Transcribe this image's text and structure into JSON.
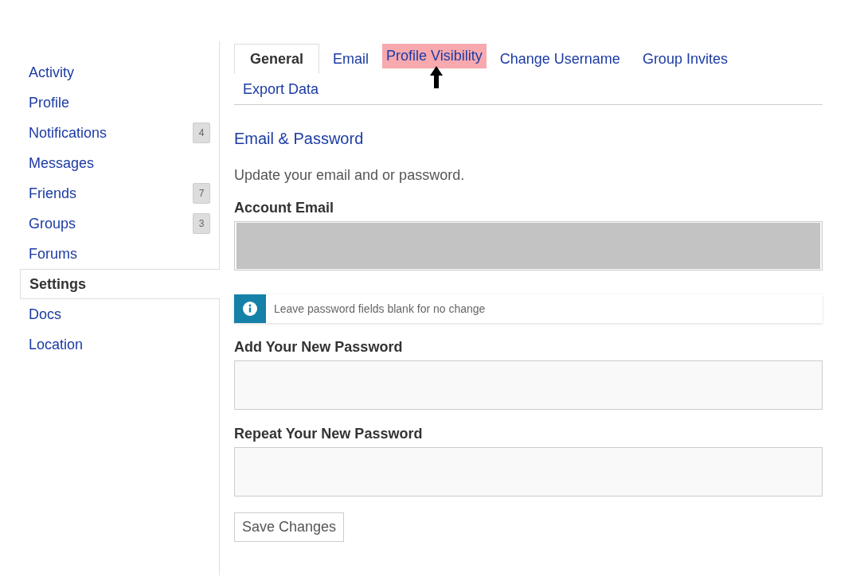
{
  "sidebar": {
    "items": [
      {
        "label": "Activity",
        "selected": false
      },
      {
        "label": "Profile",
        "selected": false
      },
      {
        "label": "Notifications",
        "selected": false,
        "count": "4"
      },
      {
        "label": "Messages",
        "selected": false
      },
      {
        "label": "Friends",
        "selected": false,
        "count": "7"
      },
      {
        "label": "Groups",
        "selected": false,
        "count": "3"
      },
      {
        "label": "Forums",
        "selected": false
      },
      {
        "label": "Settings",
        "selected": true
      },
      {
        "label": "Docs",
        "selected": false
      },
      {
        "label": "Location",
        "selected": false
      }
    ]
  },
  "tabs": [
    {
      "label": "General",
      "selected": true,
      "highlighted": false
    },
    {
      "label": "Email",
      "selected": false,
      "highlighted": false
    },
    {
      "label": "Profile Visibility",
      "selected": false,
      "highlighted": true
    },
    {
      "label": "Change Username",
      "selected": false,
      "highlighted": false
    },
    {
      "label": "Group Invites",
      "selected": false,
      "highlighted": false
    },
    {
      "label": "Export Data",
      "selected": false,
      "highlighted": false
    }
  ],
  "section": {
    "title": "Email & Password",
    "description": "Update your email and or password."
  },
  "fields": [
    {
      "label": "Account Email",
      "redacted": true
    },
    {
      "kind": "notice",
      "text": "Leave password fields blank for no change"
    },
    {
      "label": "Add Your New Password",
      "redacted": false
    },
    {
      "label": "Repeat Your New Password",
      "redacted": false
    }
  ],
  "save_button": "Save Changes"
}
